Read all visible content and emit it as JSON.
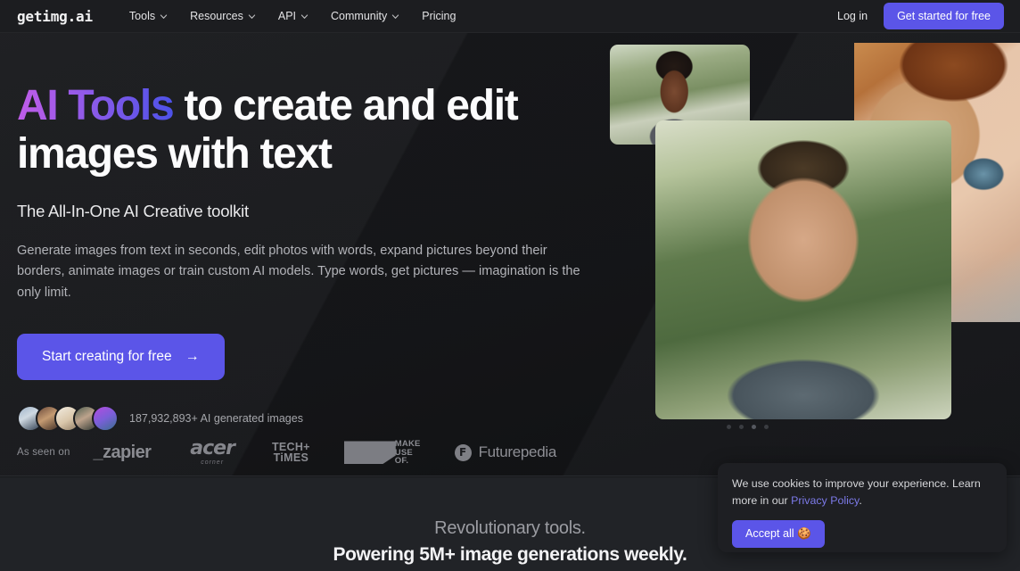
{
  "brand": {
    "logo_main": "getimg",
    "logo_dot": ".",
    "logo_suffix": "ai",
    "accent_purple": "#5b55e8",
    "gradient_start": "#c05ce8",
    "gradient_end": "#4d52e8"
  },
  "nav": {
    "items": [
      {
        "label": "Tools",
        "has_caret": true
      },
      {
        "label": "Resources",
        "has_caret": true
      },
      {
        "label": "API",
        "has_caret": true
      },
      {
        "label": "Community",
        "has_caret": true
      },
      {
        "label": "Pricing",
        "has_caret": false
      }
    ],
    "login_label": "Log in",
    "cta_label": "Get started for free"
  },
  "hero": {
    "headline_gradient": "AI Tools",
    "headline_rest": " to create and edit images with text",
    "subheadline": "The All-In-One AI Creative toolkit",
    "paragraph": "Generate images from text in seconds, edit photos with words, expand pictures beyond their borders, animate images or train custom AI models. Type words, get pictures — imagination is the only limit.",
    "cta_label": "Start creating for free",
    "cta_arrow": "→",
    "social_proof": "187,932,893+ AI generated images",
    "avatar_count": 5
  },
  "logo_strip": {
    "label": "As seen on",
    "brands": [
      {
        "name": "zapier",
        "text": "_zapier"
      },
      {
        "name": "acer-corner",
        "text": "acer",
        "sub": "corner"
      },
      {
        "name": "tech-times",
        "line1": "TECH+",
        "line2": "TiMES"
      },
      {
        "name": "makeuseof",
        "line1": "MAKE",
        "line2": "USE",
        "line3": "OF."
      },
      {
        "name": "futurepedia",
        "icon": "F",
        "text": "Futurepedia"
      }
    ]
  },
  "collage": {
    "photos": [
      {
        "name": "portrait-small-man-park",
        "alt": "Smiling man in park"
      },
      {
        "name": "portrait-woman-freckles",
        "alt": "Red haired woman with freckles"
      },
      {
        "name": "portrait-main-man",
        "alt": "Smiling young man in grey sweater"
      }
    ],
    "carousel_dots": 4,
    "carousel_active_index": 2
  },
  "lower": {
    "line_top": "Revolutionary tools.",
    "line_bottom": "Powering 5M+ image generations weekly."
  },
  "cookie": {
    "text_before": "We use cookies to improve your experience. Learn more in our ",
    "link_label": "Privacy Policy",
    "text_after": ".",
    "accept_label": "Accept all 🍪"
  }
}
